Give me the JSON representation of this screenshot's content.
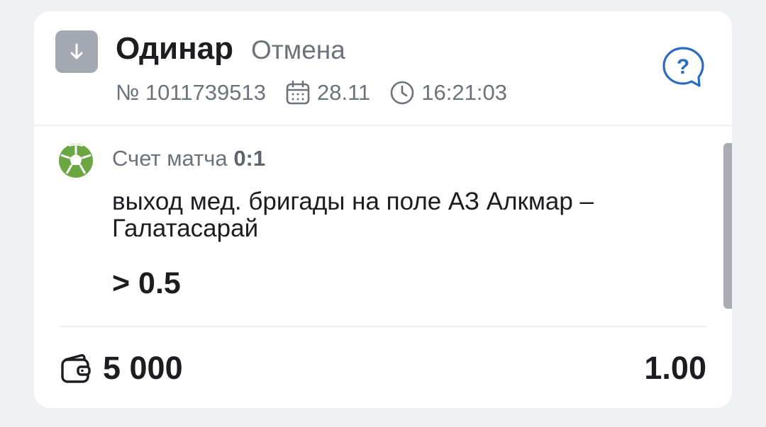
{
  "header": {
    "bet_type": "Одинар",
    "status": "Отмена",
    "ticket_number": "№ 1011739513",
    "date": "28.11",
    "time": "16:21:03",
    "help_label": "?"
  },
  "selection": {
    "sport_icon": "soccer-ball-icon",
    "score_label": "Счет матча",
    "score_value": "0:1",
    "event": "выход мед. бригады на поле АЗ Алкмар – Галатасарай",
    "outcome": "> 0.5"
  },
  "footer": {
    "wallet_icon": "wallet-icon",
    "stake": "5 000",
    "odds": "1.00"
  },
  "colors": {
    "accent_blue": "#2a6bc0",
    "soccer_green": "#6aa642",
    "muted_text": "#6d727b",
    "arrow_box": "#a4a8b0",
    "scrollbar": "#a8acb3"
  }
}
